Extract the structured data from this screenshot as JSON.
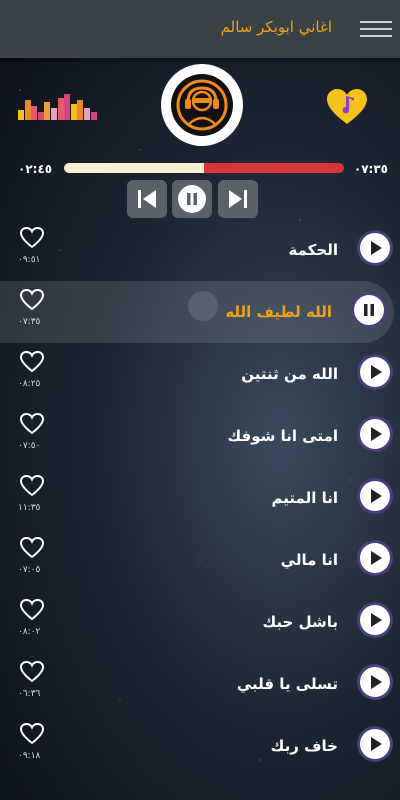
{
  "app": {
    "title": "اغاني ابوبكر سالم"
  },
  "icons": {
    "menu": "hamburger-menu-icon",
    "equalizer": "equalizer-icon",
    "logo": "headphones-avatar-icon",
    "favorite": "heart-music-note-icon",
    "prev": "skip-previous-icon",
    "pause": "pause-icon",
    "next": "skip-next-icon"
  },
  "colors": {
    "accent": "#f0a21a",
    "progress_track": "#d9363a",
    "progress_fill": "#f6efd0"
  },
  "player": {
    "elapsed": "٠٢:٤٥",
    "total": "٠٧:٣٥",
    "progress": 0.5
  },
  "tracks": [
    {
      "title": "الحكمة",
      "duration": "٠٩:٥١",
      "state": "play"
    },
    {
      "title": "الله لطيف الله",
      "duration": "٠٧:٣٥",
      "state": "pause",
      "active": true
    },
    {
      "title": "الله من ثنتين",
      "duration": "٠٨:٢٥",
      "state": "play"
    },
    {
      "title": "امتى انا شوفك",
      "duration": "٠٧:٥٠",
      "state": "play"
    },
    {
      "title": "انا المتيم",
      "duration": "١١:٣٥",
      "state": "play"
    },
    {
      "title": "انا مالي",
      "duration": "٠٧:٠٥",
      "state": "play"
    },
    {
      "title": "باشل حبك",
      "duration": "٠٨:٠٢",
      "state": "play"
    },
    {
      "title": "تسلى يا قلبي",
      "duration": "٠٦:٣٦",
      "state": "play"
    },
    {
      "title": "خاف ربك",
      "duration": "٠٩:١٨",
      "state": "play"
    }
  ]
}
